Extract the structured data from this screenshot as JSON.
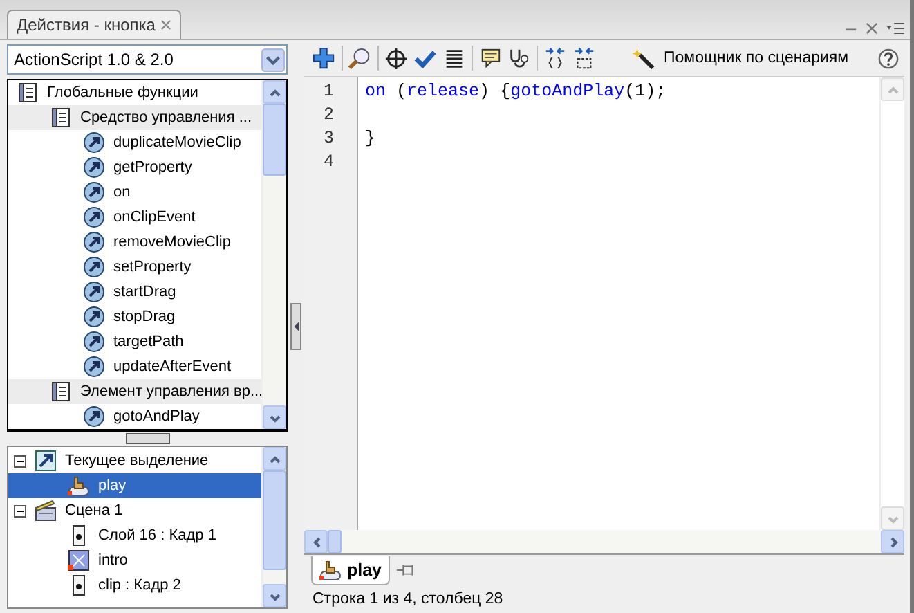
{
  "panel_tab": {
    "title": "Действия - кнопка"
  },
  "language_select": {
    "value": "ActionScript 1.0 & 2.0"
  },
  "toolbox": {
    "items": [
      {
        "label": "Глобальные функции",
        "kind": "book",
        "children": [
          {
            "label": "Средство управления ...",
            "kind": "book",
            "children": [
              {
                "label": "duplicateMovieClip",
                "kind": "function"
              },
              {
                "label": "getProperty",
                "kind": "function"
              },
              {
                "label": "on",
                "kind": "function"
              },
              {
                "label": "onClipEvent",
                "kind": "function"
              },
              {
                "label": "removeMovieClip",
                "kind": "function"
              },
              {
                "label": "setProperty",
                "kind": "function"
              },
              {
                "label": "startDrag",
                "kind": "function"
              },
              {
                "label": "stopDrag",
                "kind": "function"
              },
              {
                "label": "targetPath",
                "kind": "function"
              },
              {
                "label": "updateAfterEvent",
                "kind": "function"
              }
            ]
          },
          {
            "label": "Элемент управления вр...",
            "kind": "book",
            "children": [
              {
                "label": "gotoAndPlay",
                "kind": "function"
              }
            ]
          }
        ]
      }
    ]
  },
  "navigator": {
    "items": [
      {
        "label": "Текущее выделение",
        "kind": "selection",
        "expanded": true,
        "selected": false,
        "children": [
          {
            "label": "play",
            "kind": "button-symbol",
            "selected": true
          }
        ]
      },
      {
        "label": "Сцена 1",
        "kind": "scene",
        "expanded": true,
        "selected": false,
        "children": [
          {
            "label": "Слой 16 : Кадр 1",
            "kind": "frame",
            "selected": false
          },
          {
            "label": "intro",
            "kind": "movie-clip",
            "selected": false
          },
          {
            "label": "clip : Кадр 2",
            "kind": "frame",
            "selected": false
          }
        ]
      }
    ]
  },
  "toolbar": {
    "assistant_label": "Помощник по сценариям"
  },
  "editor": {
    "lines": [
      {
        "number": "1",
        "tokens": [
          {
            "kind": "keyword",
            "text": "on"
          },
          {
            "kind": "plain",
            "text": " ("
          },
          {
            "kind": "keyword",
            "text": "release"
          },
          {
            "kind": "plain",
            "text": ") {"
          },
          {
            "kind": "keyword",
            "text": "gotoAndPlay"
          },
          {
            "kind": "plain",
            "text": "(1);"
          }
        ]
      },
      {
        "number": "2"
      },
      {
        "number": "3",
        "tokens": [
          {
            "kind": "plain",
            "text": "}"
          }
        ]
      },
      {
        "number": "4"
      }
    ]
  },
  "script_tabs": [
    {
      "label": "play",
      "kind": "button-symbol",
      "selected": true
    }
  ],
  "status_bar": {
    "text": "Строка 1 из 4, столбец 28"
  }
}
